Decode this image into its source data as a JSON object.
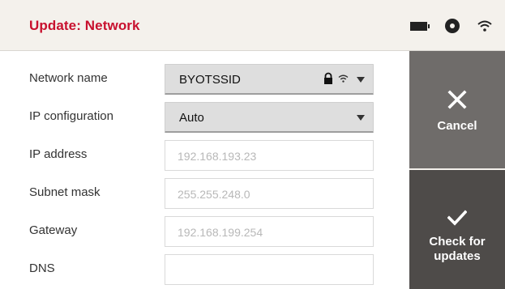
{
  "header": {
    "title": "Update: Network",
    "status_icons": [
      "battery-icon",
      "disc-icon",
      "wifi-icon"
    ],
    "title_color": "#c8102e"
  },
  "form": {
    "network_name": {
      "label": "Network name",
      "value": "BYOTSSID",
      "icons": [
        "lock-icon",
        "wifi-icon",
        "chevron-down-icon"
      ]
    },
    "ip_configuration": {
      "label": "IP configuration",
      "value": "Auto"
    },
    "ip_address": {
      "label": "IP address",
      "value": "192.168.193.23"
    },
    "subnet_mask": {
      "label": "Subnet mask",
      "value": "255.255.248.0"
    },
    "gateway": {
      "label": "Gateway",
      "value": "192.168.199.254"
    },
    "dns": {
      "label": "DNS",
      "value": ""
    }
  },
  "actions": {
    "cancel": {
      "label": "Cancel",
      "icon": "close-icon"
    },
    "check": {
      "label": "Check for updates",
      "icon": "checkmark-icon"
    }
  }
}
